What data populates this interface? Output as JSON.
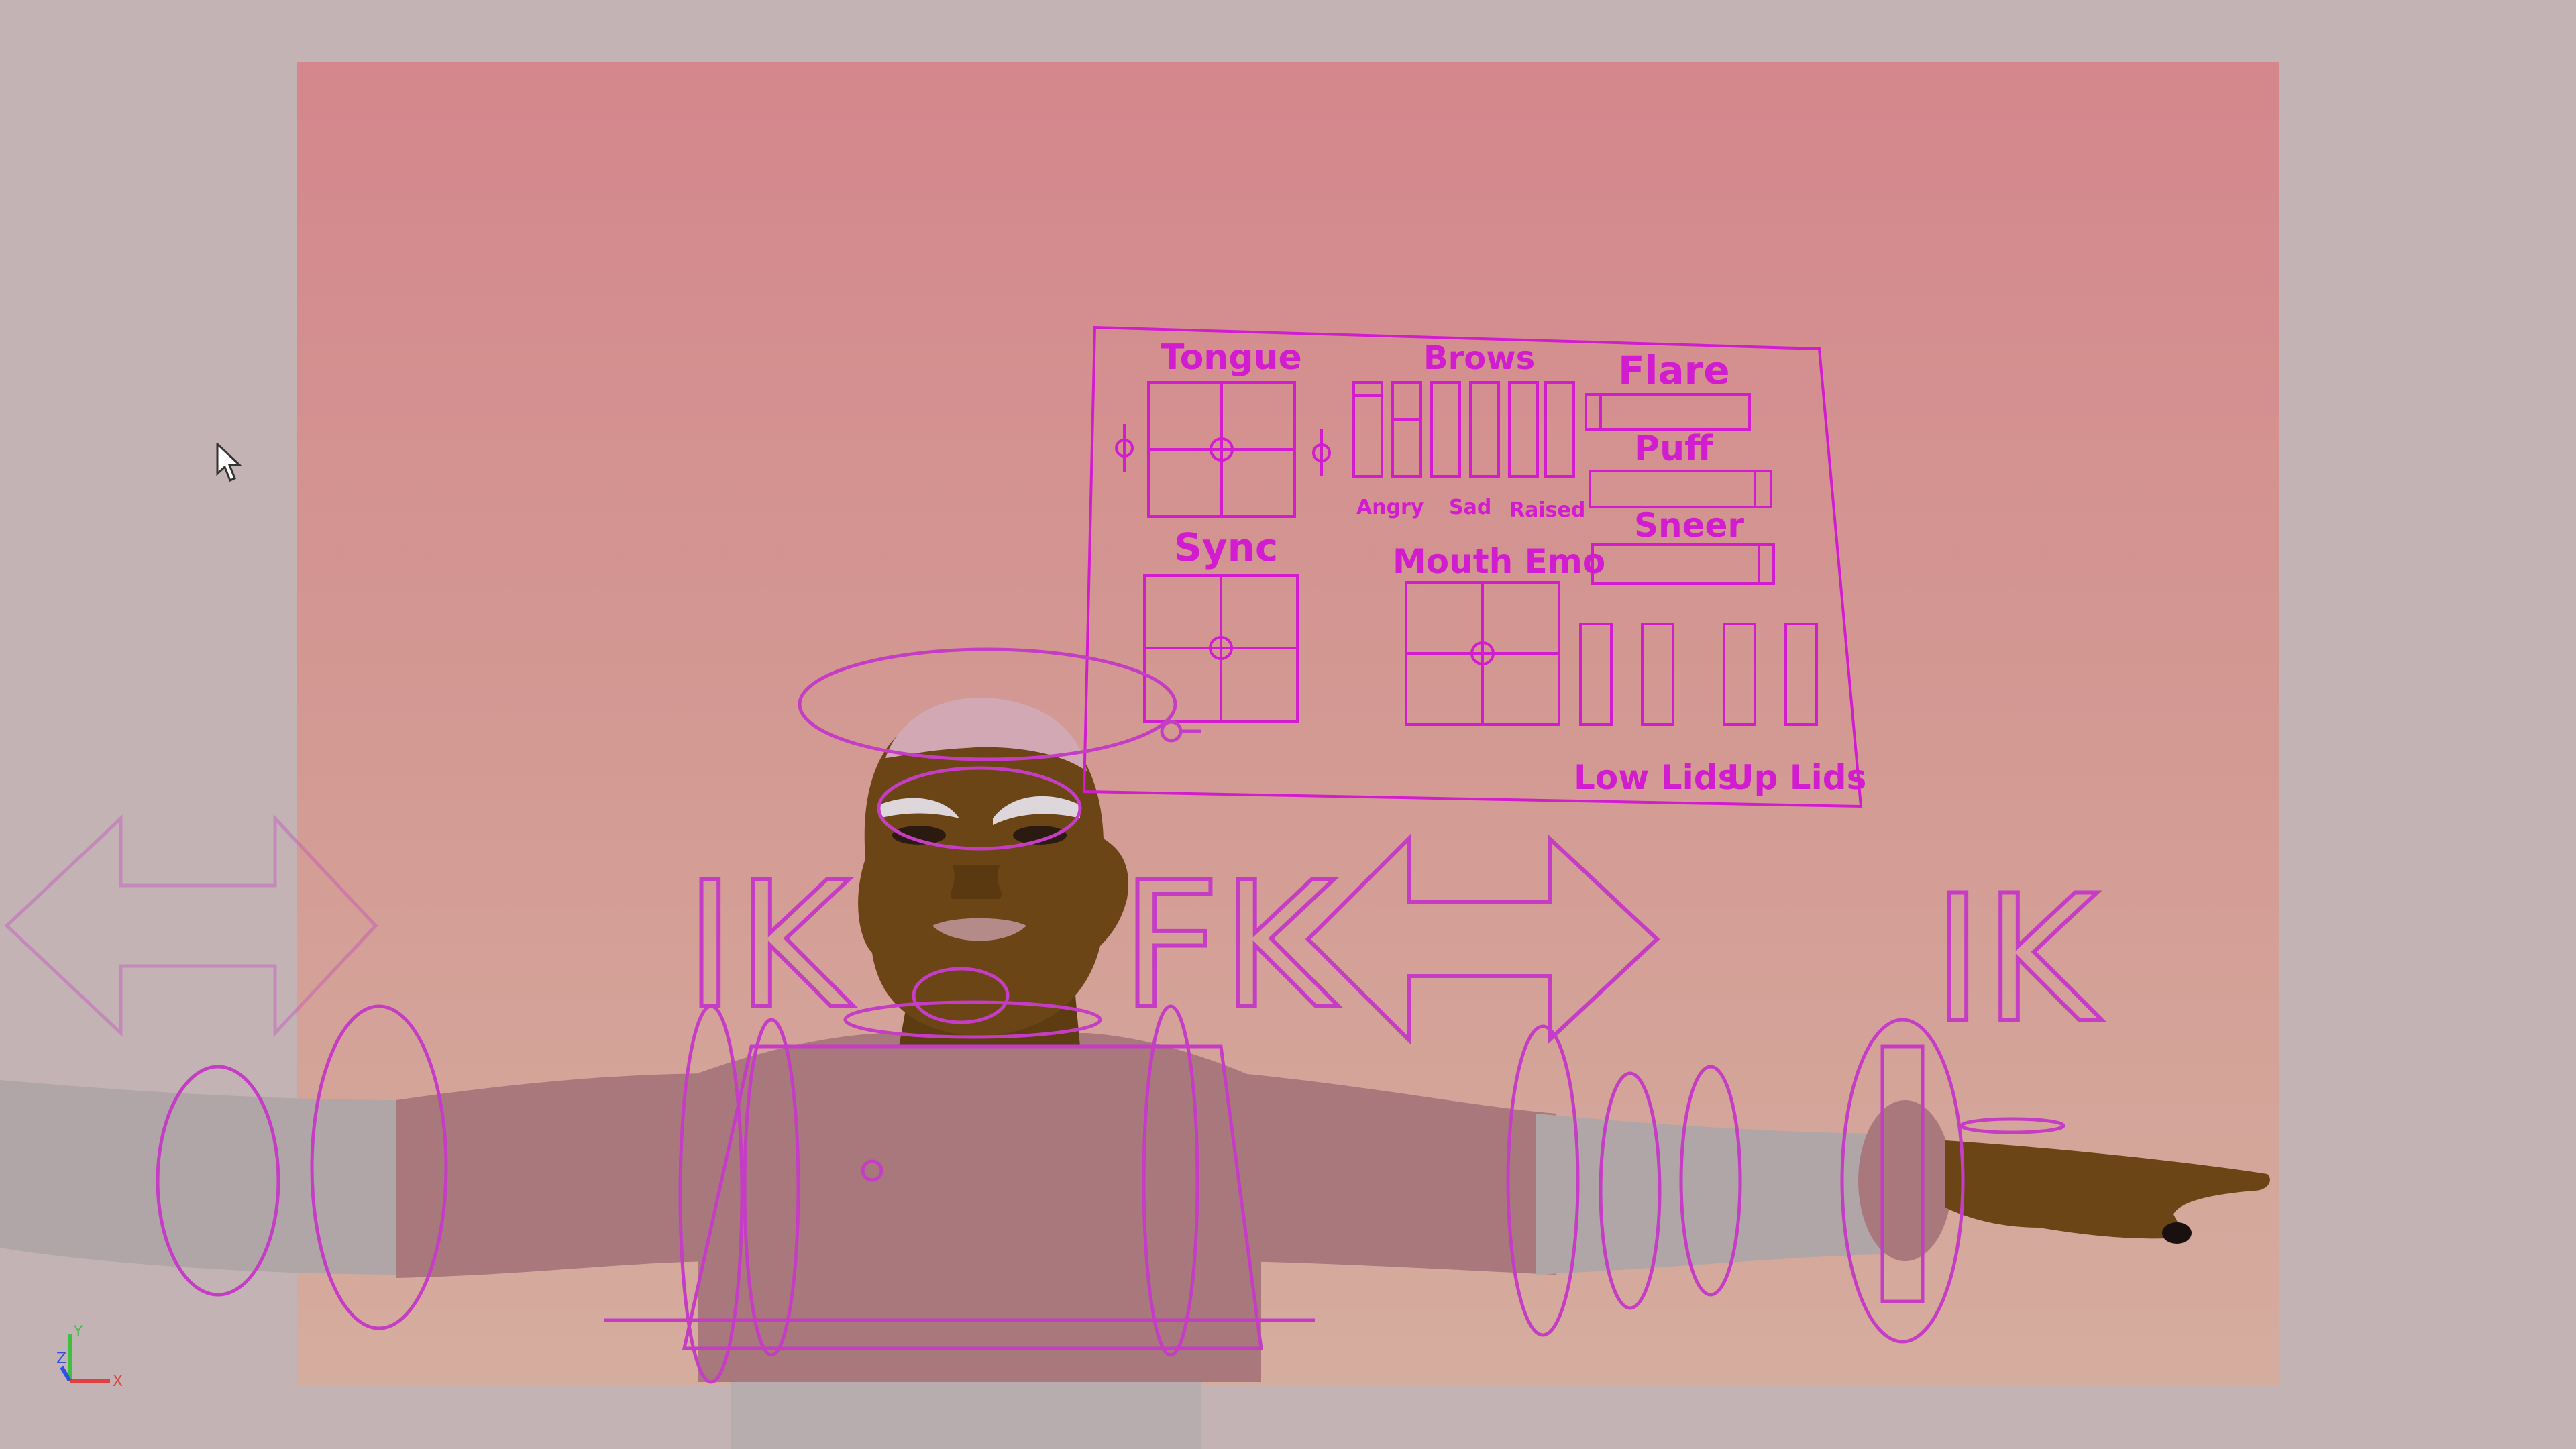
{
  "viewport": {
    "view": "perspective camera — character rig in T-pose"
  },
  "face_panel": {
    "tongue": "Tongue",
    "brows": "Brows",
    "flare": "Flare",
    "puff": "Puff",
    "sneer": "Sneer",
    "sync": "Sync",
    "mouth_emo": "Mouth Emo",
    "brow_sub": [
      "Angry",
      "Sad",
      "Raised"
    ],
    "low_lids": "Low Lids",
    "up_lids": "Up Lids"
  },
  "switch_labels": {
    "ik_left": "IK",
    "fk": "FK",
    "ik_right": "IK"
  },
  "axis_indicator": {
    "y": "Y",
    "x": "X",
    "z": "Z"
  },
  "colors": {
    "control_magenta": "#d21cd0",
    "viewport_bg": "#c4b3b4",
    "skin": "#6b4516",
    "shirt": "#a8787c",
    "sleeve": "#b0a6a7"
  }
}
